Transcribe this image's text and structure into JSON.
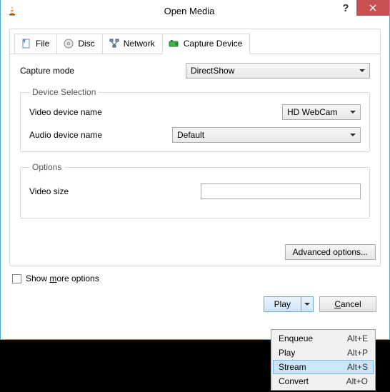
{
  "window": {
    "title": "Open Media"
  },
  "tabs": {
    "file": "File",
    "disc": "Disc",
    "network": "Network",
    "capture": "Capture Device"
  },
  "capture_panel": {
    "mode_label": "Capture mode",
    "mode_value": "DirectShow",
    "device_selection": {
      "legend": "Device Selection",
      "video_label": "Video device name",
      "video_value": "HD WebCam",
      "audio_label": "Audio device name",
      "audio_value": "Default"
    },
    "options": {
      "legend": "Options",
      "video_size_label": "Video size",
      "video_size_value": ""
    },
    "advanced": "Advanced options..."
  },
  "show_more_label_a": "Show ",
  "show_more_label_b": "m",
  "show_more_label_c": "ore options",
  "buttons": {
    "play": "Play",
    "cancel_a": "C",
    "cancel_b": "ancel"
  },
  "dropdown": {
    "items": [
      {
        "label": "Enqueue",
        "shortcut": "Alt+E"
      },
      {
        "label": "Play",
        "shortcut": "Alt+P"
      },
      {
        "label": "Stream",
        "shortcut": "Alt+S"
      },
      {
        "label": "Convert",
        "shortcut": "Alt+O"
      }
    ],
    "highlighted_index": 2
  }
}
